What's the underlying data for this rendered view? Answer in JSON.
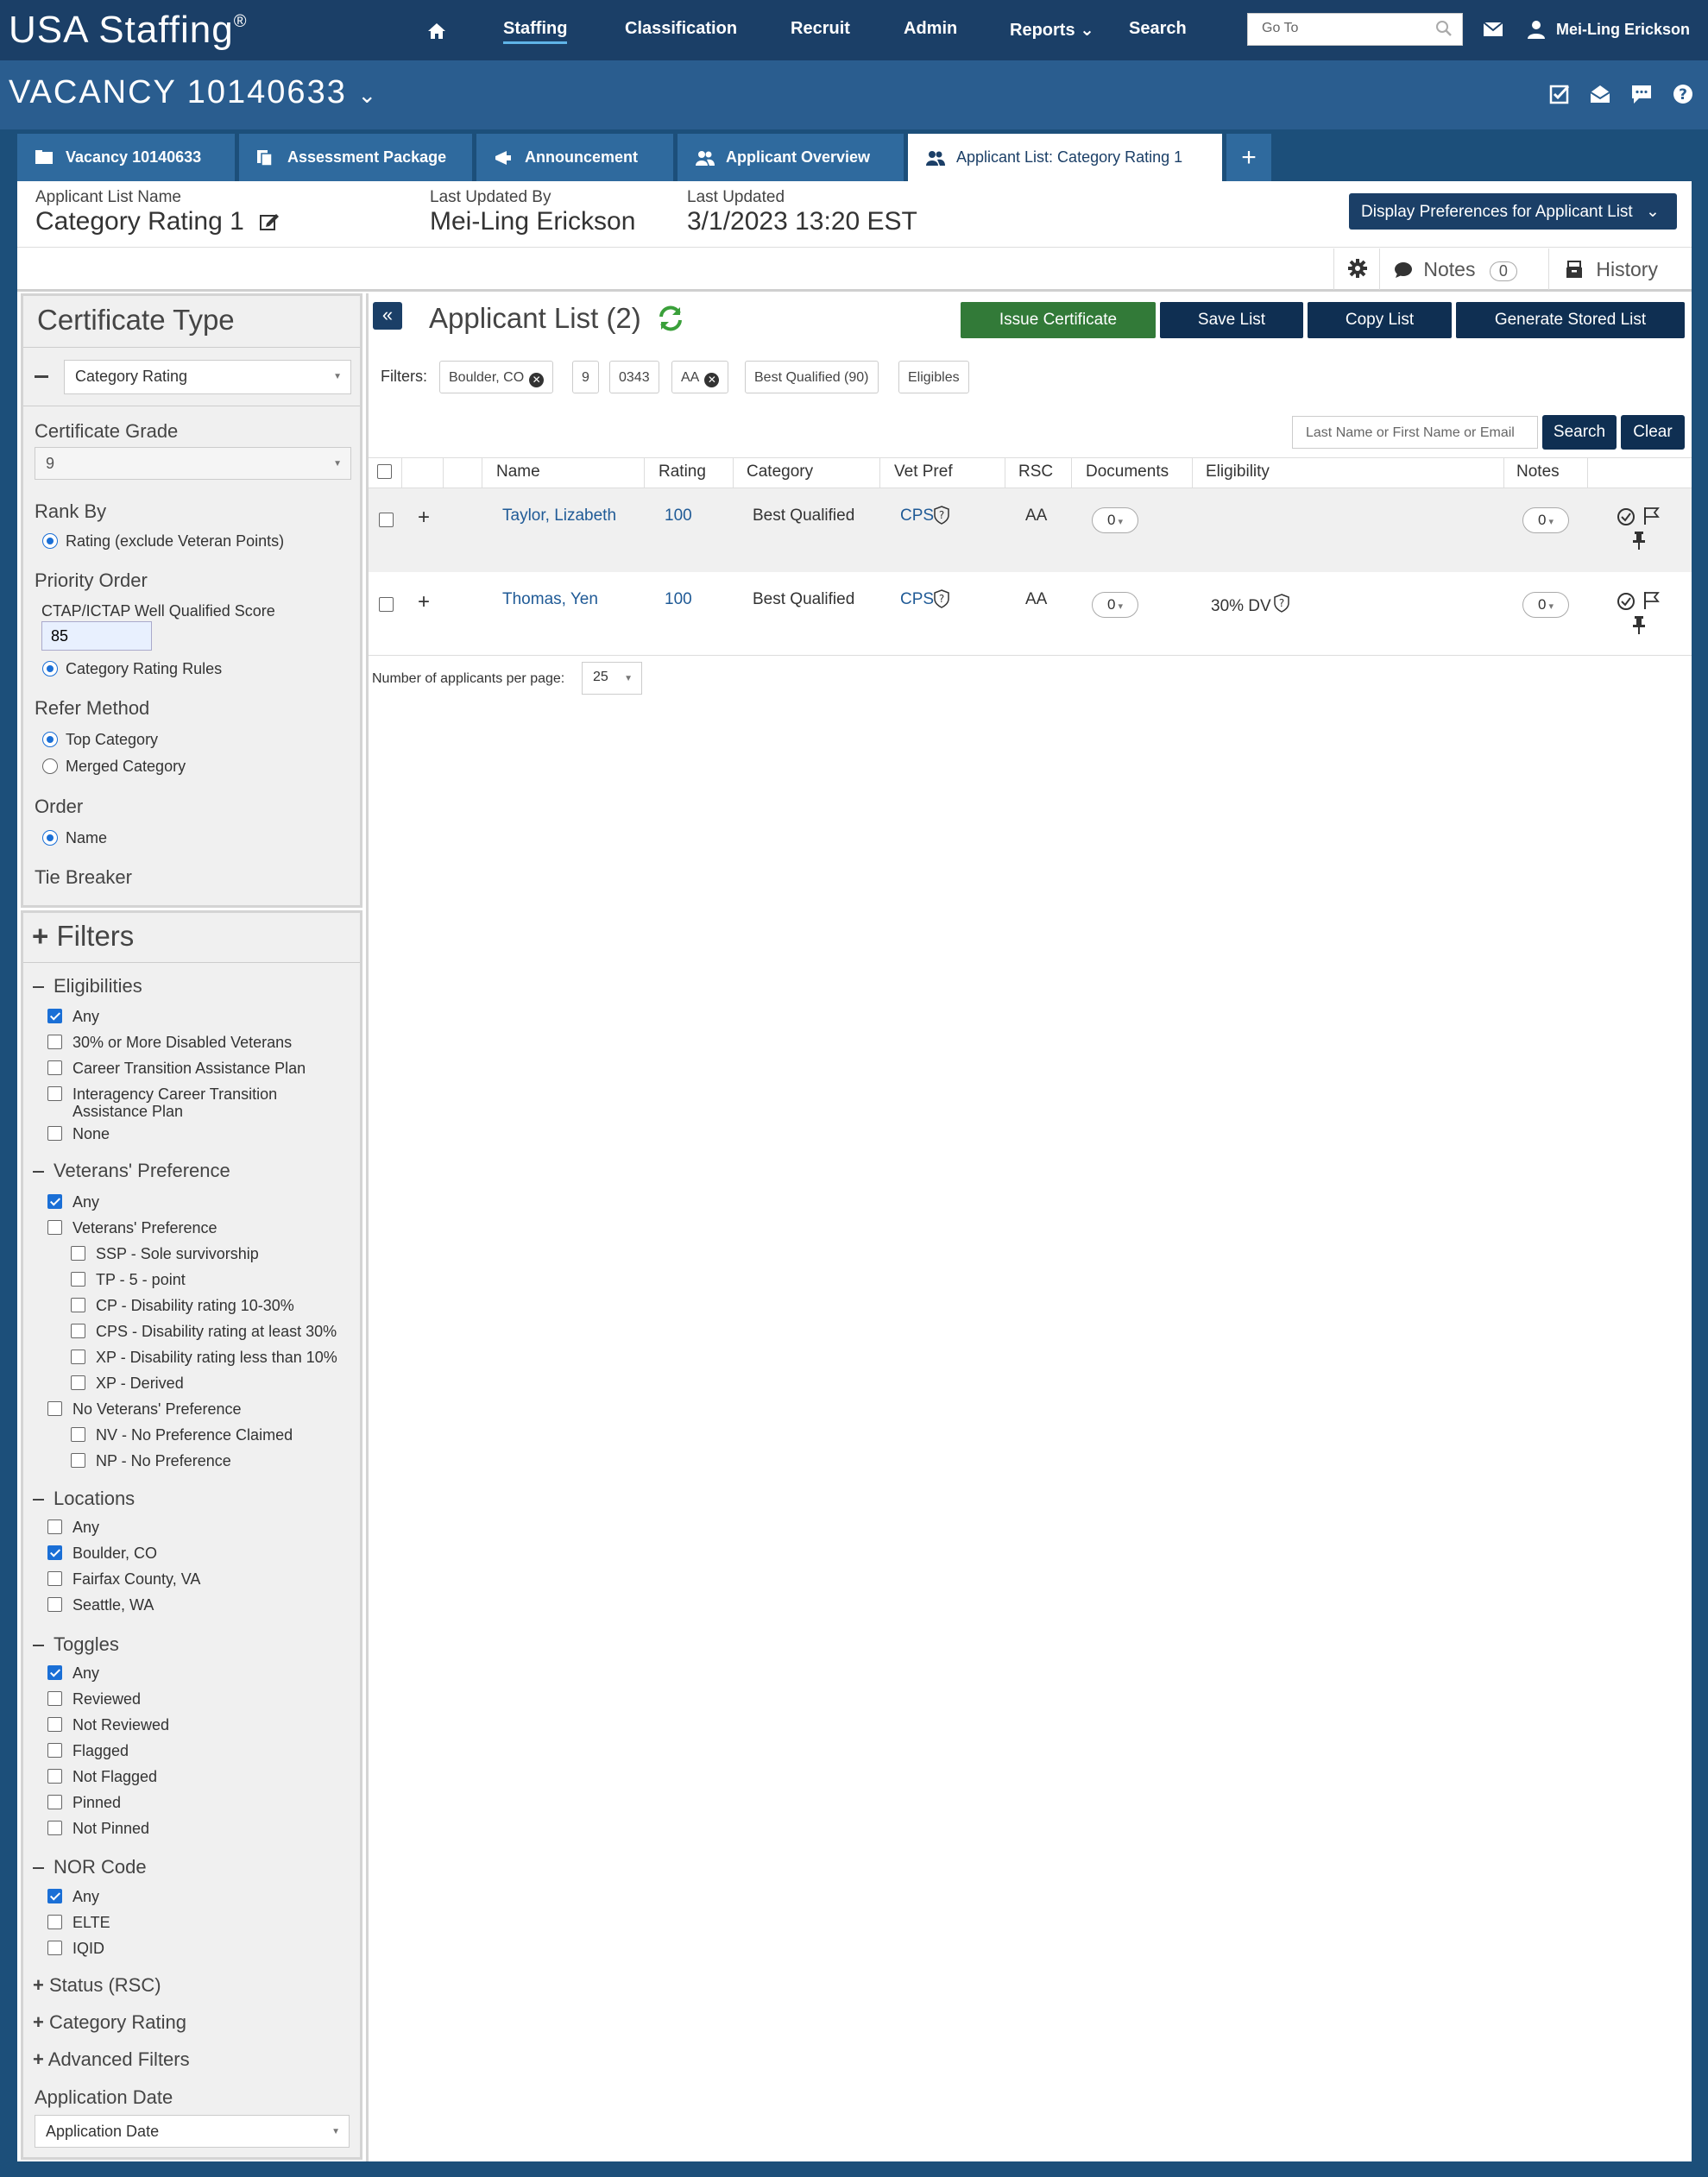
{
  "app": {
    "logo": "USA Staffing",
    "logo_mark": "®"
  },
  "nav": {
    "items": [
      {
        "label": "Staffing",
        "active": true
      },
      {
        "label": "Classification"
      },
      {
        "label": "Recruit"
      },
      {
        "label": "Admin"
      },
      {
        "label": "Reports"
      },
      {
        "label": "Search"
      }
    ],
    "goto_placeholder": "Go To",
    "user_name": "Mei-Ling Erickson"
  },
  "vacancy": {
    "title": "VACANCY 10140633"
  },
  "tabs": [
    {
      "label": "Vacancy 10140633"
    },
    {
      "label": "Assessment Package"
    },
    {
      "label": "Announcement"
    },
    {
      "label": "Applicant Overview"
    },
    {
      "label": "Applicant List: Category Rating 1",
      "active": true
    }
  ],
  "header": {
    "list_name_label": "Applicant List Name",
    "list_name": "Category Rating 1",
    "updated_by_label": "Last Updated By",
    "updated_by": "Mei-Ling Erickson",
    "updated_label": "Last Updated",
    "updated": "3/1/2023 13:20 EST",
    "display_prefs": "Display Preferences for Applicant List"
  },
  "toolbar": {
    "notes_label": "Notes",
    "notes_count": "0",
    "history_label": "History"
  },
  "certificate": {
    "title": "Certificate Type",
    "type_value": "Category Rating",
    "grade_label": "Certificate Grade",
    "grade_value": "9",
    "rank_by_label": "Rank By",
    "rank_by_option": "Rating (exclude Veteran Points)",
    "priority_label": "Priority Order",
    "ctap_label": "CTAP/ICTAP Well Qualified Score",
    "ctap_value": "85",
    "priority_option": "Category Rating Rules",
    "refer_label": "Refer Method",
    "refer_options": [
      "Top Category",
      "Merged Category"
    ],
    "order_label": "Order",
    "order_option": "Name",
    "tie_label": "Tie Breaker"
  },
  "filters": {
    "title": "Filters",
    "eligibilities": {
      "label": "Eligibilities",
      "options": [
        "Any",
        "30% or More Disabled Veterans",
        "Career Transition Assistance Plan",
        "Interagency Career Transition",
        "Assistance Plan",
        "None"
      ]
    },
    "vet_pref": {
      "label": "Veterans' Preference",
      "options": [
        "Any",
        "Veterans' Preference",
        "SSP - Sole survivorship",
        "TP - 5 - point",
        "CP - Disability rating 10-30%",
        "CPS - Disability rating at least 30%",
        "XP - Disability rating less than 10%",
        "XP - Derived",
        "No Veterans' Preference",
        "NV - No Preference Claimed",
        "NP - No Preference"
      ]
    },
    "locations": {
      "label": "Locations",
      "options": [
        "Any",
        "Boulder, CO",
        "Fairfax County, VA",
        "Seattle, WA"
      ]
    },
    "toggles": {
      "label": "Toggles",
      "options": [
        "Any",
        "Reviewed",
        "Not Reviewed",
        "Flagged",
        "Not Flagged",
        "Pinned",
        "Not Pinned"
      ]
    },
    "nor": {
      "label": "NOR Code",
      "options": [
        "Any",
        "ELTE",
        "IQID"
      ]
    },
    "collapsed": [
      "Status (RSC)",
      "Category Rating",
      "Advanced Filters"
    ],
    "app_date_label": "Application Date",
    "app_date_value": "Application Date"
  },
  "list": {
    "title": "Applicant List (2)",
    "buttons": {
      "issue": "Issue Certificate",
      "save": "Save List",
      "copy": "Copy List",
      "generate": "Generate Stored List"
    },
    "filters_label": "Filters:",
    "chips": [
      "Boulder, CO",
      "9",
      "0343",
      "AA",
      "Best Qualified (90)",
      "Eligibles"
    ],
    "search_placeholder": "Last Name or First Name or Email",
    "search_btn": "Search",
    "clear_btn": "Clear",
    "columns": [
      "Name",
      "Rating",
      "Category",
      "Vet Pref",
      "RSC",
      "Documents",
      "Eligibility",
      "Notes"
    ],
    "rows": [
      {
        "name": "Taylor, Lizabeth",
        "rating": "100",
        "category": "Best Qualified",
        "vet_pref": "CPS",
        "rsc": "AA",
        "documents": "0",
        "eligibility": "",
        "notes": "0"
      },
      {
        "name": "Thomas, Yen",
        "rating": "100",
        "category": "Best Qualified",
        "vet_pref": "CPS",
        "rsc": "AA",
        "documents": "0",
        "eligibility": "30% DV",
        "notes": "0"
      }
    ],
    "per_page_label": "Number of applicants per page:",
    "per_page_value": "25"
  },
  "colors": {
    "nav": "#1b3f67",
    "bar": "#2a5d8f",
    "issue": "#327a38",
    "primary": "#0f2f52",
    "link": "#1f5a96"
  }
}
